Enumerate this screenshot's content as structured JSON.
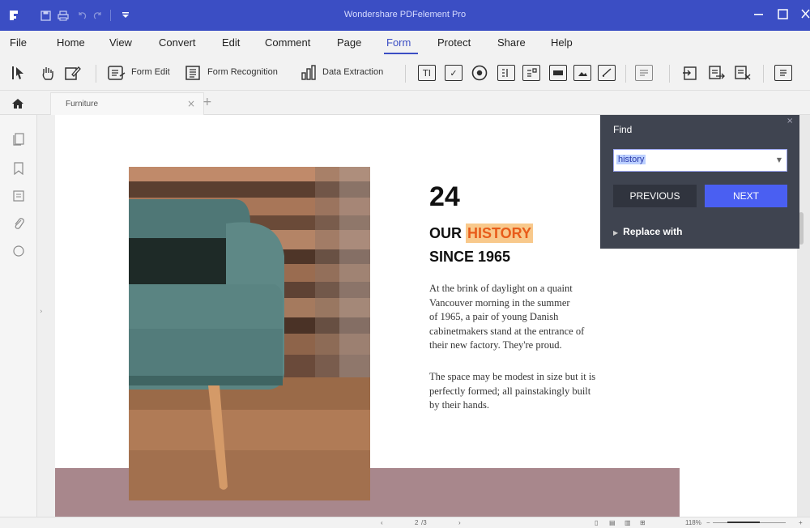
{
  "app": {
    "title": "Wondershare PDFelement Pro",
    "accent_color": "#3b4ec4",
    "quick_access_icons": [
      "app-logo-icon",
      "save-icon",
      "print-icon",
      "undo-icon",
      "redo-icon",
      "customize-dropdown-icon"
    ]
  },
  "menu": {
    "items": [
      "File",
      "Home",
      "View",
      "Convert",
      "Edit",
      "Comment",
      "Page",
      "Form",
      "Protect",
      "Share",
      "Help"
    ],
    "active": "Form"
  },
  "toolbar": {
    "form_edit": "Form Edit",
    "form_recognition": "Form Recognition",
    "data_extraction": "Data Extraction",
    "field_icons": [
      "text-field-icon",
      "checkbox-icon",
      "radio-button-icon",
      "list-box-icon",
      "combo-box-icon",
      "button-field-icon",
      "image-field-icon",
      "signature-field-icon",
      "form-fields-icon",
      "import-data-icon",
      "export-data-icon",
      "clear-form-icon",
      "data-icon"
    ]
  },
  "tabs": {
    "document": "Furniture",
    "close": "×",
    "add": "+"
  },
  "document": {
    "number": "24",
    "heading_pre": "OUR ",
    "heading_highlight": "HISTORY",
    "heading_line2": "SINCE 1965",
    "paragraph1": [
      "At the brink of daylight on a quaint",
      "Vancouver morning in the summer",
      "of 1965, a pair of young Danish",
      "cabinetmakers stand at the entrance of",
      "their new factory. They're proud."
    ],
    "paragraph2": [
      "The space may be modest in size but it is",
      "perfectly formed; all painstakingly built",
      "by their hands."
    ],
    "highlight_color": "#f8c98c",
    "band_color": "#a8878c"
  },
  "find_panel": {
    "title": "Find",
    "query": "history",
    "previous_label": "PREVIOUS",
    "next_label": "NEXT",
    "replace_label": "Replace with",
    "close": "×"
  },
  "status": {
    "page": "2",
    "page_of": "/3",
    "zoom": "118%"
  }
}
